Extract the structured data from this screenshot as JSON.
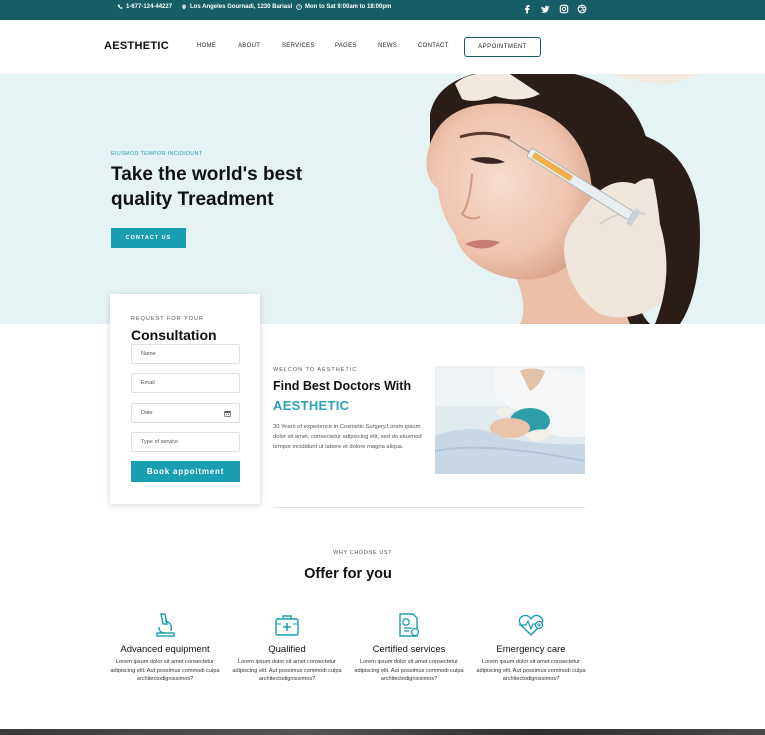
{
  "topbar": {
    "phone": "1-677-124-44227",
    "address": "Los Angeles Gournadi, 1230 Bariasl",
    "hours": "Mon to Sat 9:00am to 18:00pm",
    "social_icons": [
      "facebook-icon",
      "twitter-icon",
      "instagram-icon",
      "dribbble-icon"
    ]
  },
  "nav": {
    "logo": "AESTHETIC",
    "menu": [
      "HOME",
      "ABOUT",
      "SERVICES",
      "PAGES",
      "NEWS",
      "CONTACT"
    ],
    "appointment": "APPOINTMENT"
  },
  "hero": {
    "eyebrow": "EIUSMOD TEMPOR INCIDIDUNT",
    "title": "Take the world's best quality Treadment",
    "button": "CONTACT US"
  },
  "consultation": {
    "eyebrow": "REQUEST FOR YOUR",
    "title": "Consultation",
    "fields": {
      "name_placeholder": "Name",
      "email_placeholder": "Email",
      "date_placeholder": "Date",
      "service_placeholder": "Type of service"
    },
    "button": "Book appoitment"
  },
  "about": {
    "eyebrow": "WELCON TO AESTHETIC",
    "title": "Find Best Doctors With",
    "brand": "AESTHETIC",
    "text": "30 Years of experience in Cosmetic Surgery.Lorem ipsum dolor sit amet, consectetur adipiscing elit, sed do eiusmod tempor incididunt ut labore et dolore magna aliqua."
  },
  "offer": {
    "eyebrow": "WHY CHOOSE US?",
    "title": "Offer for you",
    "items": [
      {
        "icon": "microscope-icon",
        "name": "Advanced equipment",
        "desc": "Lorem ipsum dolor sit amet consectetur adipiscing elit. Aut possimus commodi culpa architectodignissimos?"
      },
      {
        "icon": "medical-kit-icon",
        "name": "Qualified",
        "desc": "Lorem ipsum dolor sit amet consectetur adipiscing elit. Aut possimus commodi culpa architectodignissimos?"
      },
      {
        "icon": "certificate-icon",
        "name": "Certified services",
        "desc": "Lorem ipsum dolor sit amet consectetur adipiscing elit. Aut possimus commodi culpa architectodignissimos?"
      },
      {
        "icon": "heart-pulse-icon",
        "name": "Emergency care",
        "desc": "Lorem ipsum dolor sit amet consectetur adipiscing elit. Aut possimus commodi culpa architectodignissimos?"
      }
    ]
  },
  "colors": {
    "topbar": "#155e68",
    "accent": "#1a9fb2",
    "hero_bg": "#e6f3f5",
    "brand_text": "#2aa3b5"
  }
}
